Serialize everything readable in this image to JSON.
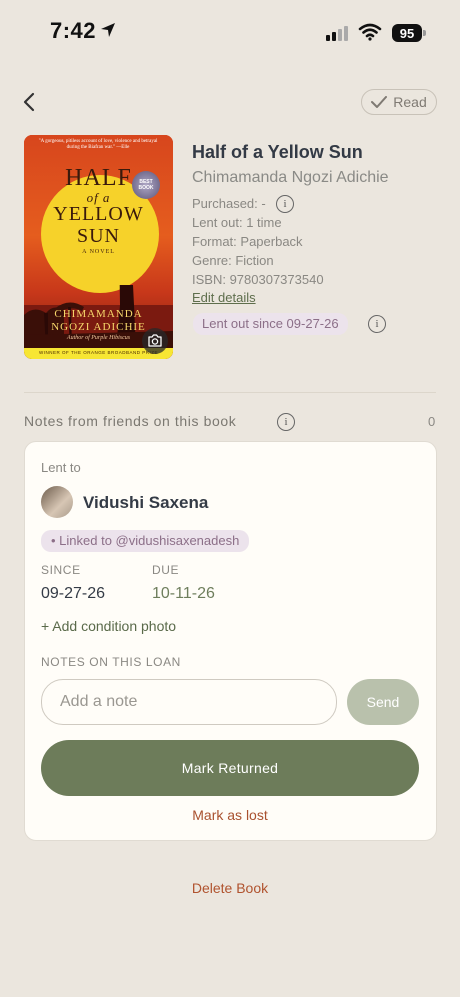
{
  "status": {
    "time": "7:42",
    "battery": "95"
  },
  "header": {
    "read_label": "Read"
  },
  "cover": {
    "quote": "\"A gorgeous, pitiless account of love, violence and betrayal during the Biafran war.\" —Elle",
    "title_line1": "HALF",
    "title_line2": "of a",
    "title_line3": "YELLOW",
    "title_line4": "SUN",
    "novel": "A NOVEL",
    "author_line1": "CHIMAMANDA",
    "author_line2": "NGOZI ADICHIE",
    "subline": "Author of Purple Hibiscus",
    "prize": "WINNER OF THE ORANGE BROADBAND PRIZE",
    "badge": "BEST BOOK"
  },
  "book": {
    "title": "Half of a Yellow Sun",
    "author": "Chimamanda Ngozi Adichie",
    "purchased": "Purchased: -",
    "lent_out": "Lent out: 1 time",
    "format": "Format: Paperback",
    "genre": "Genre: Fiction",
    "isbn": "ISBN: 9780307373540",
    "edit_label": "Edit details",
    "lent_status": "Lent out since 09-27-26"
  },
  "notes_section": {
    "heading": "Notes from friends on this book",
    "count": "0"
  },
  "loan": {
    "lent_to_label": "Lent to",
    "friend_name": "Vidushi Saxena",
    "linked": "Linked to @vidushisaxenadesh",
    "since_label": "SINCE",
    "since_value": "09-27-26",
    "due_label": "DUE",
    "due_value": "10-11-26",
    "add_photo": "+ Add condition photo",
    "notes_label": "NOTES ON THIS LOAN",
    "note_placeholder": "Add a note",
    "send_label": "Send",
    "mark_returned": "Mark Returned",
    "mark_lost": "Mark as lost"
  },
  "footer": {
    "delete_label": "Delete Book"
  },
  "colors": {
    "accent": "#6d7c5a",
    "danger": "#a9512f",
    "background": "#ebe6de"
  }
}
